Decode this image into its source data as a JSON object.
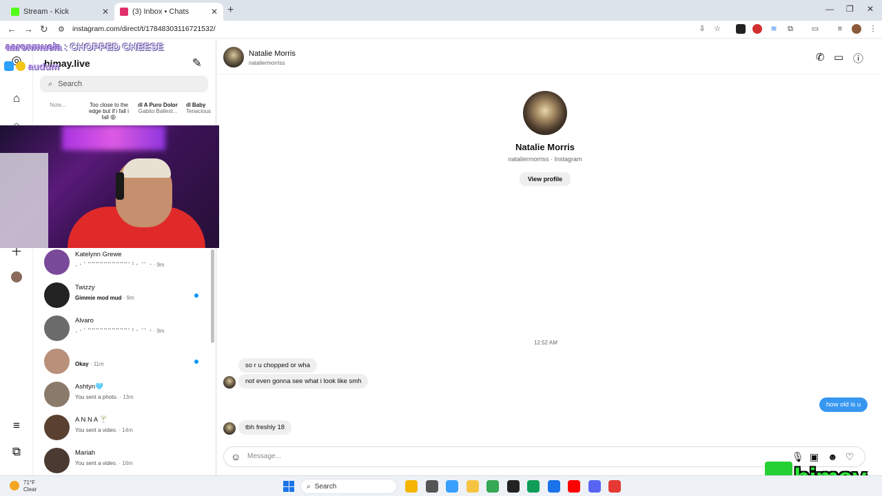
{
  "browser": {
    "tabs": [
      {
        "label": "Stream - Kick",
        "close": "✕",
        "fav_color": "#53fc18"
      },
      {
        "label": "(3) Inbox • Chats",
        "close": "✕",
        "fav_color": "#e1306c"
      }
    ],
    "new_tab": "+",
    "url": "instagram.com/direct/t/17848303116721532/",
    "window_controls": {
      "minimize": "—",
      "restore": "❐",
      "close": "✕"
    },
    "nav": {
      "back": "←",
      "forward": "→",
      "reload": "↻"
    }
  },
  "stream_overlay": {
    "chat_user": "aaronmuela",
    "chat_message": " : CHOPPED CHEESE",
    "chat_user2": "audum",
    "badge_colors": [
      "#2aa0ff",
      "#f5c518"
    ],
    "brand": "himay",
    "brand_color": "#2ee43a"
  },
  "rail": {
    "icons": [
      "instagram-icon",
      "home-icon",
      "search-icon",
      "create-icon",
      "profile-icon",
      "menu-icon",
      "threads-icon"
    ]
  },
  "inbox": {
    "username": "himay.live",
    "compose_icon": "✎",
    "search_placeholder": "Search",
    "notes": [
      {
        "title": "Note...",
        "sub": ""
      },
      {
        "title": "Too close to the edge but if i fall i fall 😩",
        "sub": ""
      },
      {
        "title": "ıll A Puro Dolor",
        "sub": "Gabito Ballest..."
      },
      {
        "title": "ıll Baby",
        "sub": "Tenacious"
      }
    ],
    "threads": [
      {
        "name": "Katelynn Grewe",
        "preview": "⠄⠂⠁⠉⠉⠉⠉⠉⠉⠉⠉⠉⠉⠁⠃⠂⠈⠁⠐",
        "time": "· 9m",
        "bold": false,
        "unread": false,
        "avatar": "#7a4a9a"
      },
      {
        "name": "Twizzy",
        "preview": "Gimmie mod mud",
        "time": "· 9m",
        "bold": true,
        "unread": true,
        "avatar": "#222222"
      },
      {
        "name": "Alvaro",
        "preview": "⠄⠂⠁⠉⠉⠉⠉⠉⠉⠉⠉⠉⠉⠁⠃⠂⠈⠁⠐",
        "time": "· 9m",
        "bold": false,
        "unread": false,
        "avatar": "#6b6b6b"
      },
      {
        "name": "",
        "preview": "Okay",
        "time": "· 11m",
        "bold": true,
        "unread": true,
        "avatar": "#b9907a"
      },
      {
        "name": "Ashtyn🩵",
        "preview": "You sent a photo.",
        "time": "· 13m",
        "bold": false,
        "unread": false,
        "avatar": "#8a7a6a"
      },
      {
        "name": "A N N A 🍸",
        "preview": "You sent a video.",
        "time": "· 14m",
        "bold": false,
        "unread": false,
        "avatar": "#5a4030"
      },
      {
        "name": "Mariah",
        "preview": "You sent a video.",
        "time": "· 16m",
        "bold": false,
        "unread": false,
        "avatar": "#4a3a32"
      }
    ]
  },
  "chat": {
    "name": "Natalie Morris",
    "handle": "nataliermorriss",
    "profile_sub": "nataliermorriss · Instagram",
    "view_profile": "View profile",
    "timestamp": "12:52 AM",
    "messages": [
      {
        "text": "so r u chopped or wha",
        "dir": "in"
      },
      {
        "text": "not even gonna see what i look like smh",
        "dir": "in"
      },
      {
        "text": "how old is u",
        "dir": "out"
      },
      {
        "text": "tbh freshly 18",
        "dir": "in"
      }
    ],
    "composer_placeholder": "Message...",
    "header_icons": [
      "phone-icon",
      "video-icon",
      "info-icon"
    ]
  },
  "taskbar": {
    "weather_temp": "71°F",
    "weather_cond": "Clear",
    "weather_badge": "3",
    "search_label": "Search",
    "apps": [
      "#f4b400",
      "#555555",
      "#3aa0ff",
      "#f5c542",
      "#34a853",
      "#222222",
      "#0f9d58",
      "#1a73e8",
      "#ff0000",
      "#5865f2",
      "#e53935"
    ]
  }
}
